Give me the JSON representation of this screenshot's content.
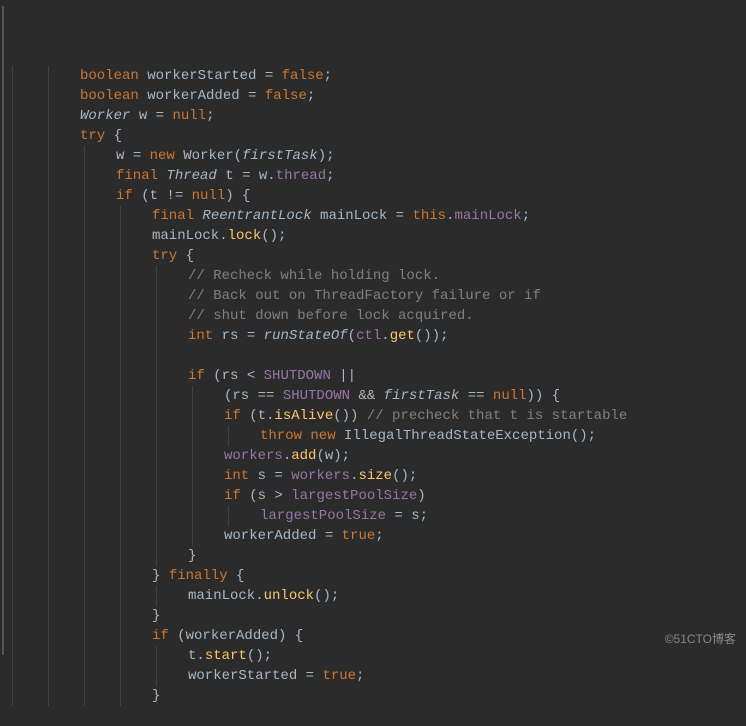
{
  "watermark": "©51CTO博客",
  "code": {
    "lines": [
      {
        "indent": 2,
        "tokens": [
          [
            "kw",
            "boolean"
          ],
          [
            "plain",
            " workerStarted "
          ],
          [
            "op",
            "="
          ],
          [
            "plain",
            " "
          ],
          [
            "kw",
            "false"
          ],
          [
            "plain",
            ";"
          ]
        ]
      },
      {
        "indent": 2,
        "tokens": [
          [
            "kw",
            "boolean"
          ],
          [
            "plain",
            " workerAdded "
          ],
          [
            "op",
            "="
          ],
          [
            "plain",
            " "
          ],
          [
            "kw",
            "false"
          ],
          [
            "plain",
            ";"
          ]
        ]
      },
      {
        "indent": 2,
        "tokens": [
          [
            "type",
            "Worker"
          ],
          [
            "plain",
            " w "
          ],
          [
            "op",
            "="
          ],
          [
            "plain",
            " "
          ],
          [
            "kw",
            "null"
          ],
          [
            "plain",
            ";"
          ]
        ]
      },
      {
        "indent": 2,
        "tokens": [
          [
            "kw",
            "try"
          ],
          [
            "plain",
            " {"
          ]
        ]
      },
      {
        "indent": 3,
        "tokens": [
          [
            "plain",
            "w "
          ],
          [
            "op",
            "="
          ],
          [
            "plain",
            " "
          ],
          [
            "kw",
            "new"
          ],
          [
            "plain",
            " Worker("
          ],
          [
            "param",
            "firstTask"
          ],
          [
            "plain",
            ");"
          ]
        ]
      },
      {
        "indent": 3,
        "tokens": [
          [
            "kw",
            "final"
          ],
          [
            "plain",
            " "
          ],
          [
            "type",
            "Thread"
          ],
          [
            "plain",
            " t "
          ],
          [
            "op",
            "="
          ],
          [
            "plain",
            " w."
          ],
          [
            "field",
            "thread"
          ],
          [
            "plain",
            ";"
          ]
        ]
      },
      {
        "indent": 3,
        "tokens": [
          [
            "kw",
            "if"
          ],
          [
            "plain",
            " (t "
          ],
          [
            "op",
            "!="
          ],
          [
            "plain",
            " "
          ],
          [
            "kw",
            "null"
          ],
          [
            "plain",
            ") {"
          ]
        ]
      },
      {
        "indent": 4,
        "tokens": [
          [
            "kw",
            "final"
          ],
          [
            "plain",
            " "
          ],
          [
            "type",
            "ReentrantLock"
          ],
          [
            "plain",
            " mainLock "
          ],
          [
            "op",
            "="
          ],
          [
            "plain",
            " "
          ],
          [
            "kw",
            "this"
          ],
          [
            "plain",
            "."
          ],
          [
            "field",
            "mainLock"
          ],
          [
            "plain",
            ";"
          ]
        ]
      },
      {
        "indent": 4,
        "tokens": [
          [
            "plain",
            "mainLock."
          ],
          [
            "fn",
            "lock"
          ],
          [
            "plain",
            "();"
          ]
        ]
      },
      {
        "indent": 4,
        "tokens": [
          [
            "kw",
            "try"
          ],
          [
            "plain",
            " {"
          ]
        ]
      },
      {
        "indent": 5,
        "tokens": [
          [
            "comment",
            "// Recheck while holding lock."
          ]
        ]
      },
      {
        "indent": 5,
        "tokens": [
          [
            "comment",
            "// Back out on ThreadFactory failure or if"
          ]
        ]
      },
      {
        "indent": 5,
        "tokens": [
          [
            "comment",
            "// shut down before lock acquired."
          ]
        ]
      },
      {
        "indent": 5,
        "tokens": [
          [
            "kw",
            "int"
          ],
          [
            "plain",
            " rs "
          ],
          [
            "op",
            "="
          ],
          [
            "plain",
            " "
          ],
          [
            "param",
            "runStateOf"
          ],
          [
            "plain",
            "("
          ],
          [
            "field",
            "ctl"
          ],
          [
            "plain",
            "."
          ],
          [
            "fn",
            "get"
          ],
          [
            "plain",
            "());"
          ]
        ]
      },
      {
        "indent": 5,
        "tokens": [
          [
            "plain",
            ""
          ]
        ]
      },
      {
        "indent": 5,
        "tokens": [
          [
            "kw",
            "if"
          ],
          [
            "plain",
            " (rs "
          ],
          [
            "op",
            "<"
          ],
          [
            "plain",
            " "
          ],
          [
            "static-field",
            "SHUTDOWN"
          ],
          [
            "plain",
            " "
          ],
          [
            "op",
            "||"
          ]
        ]
      },
      {
        "indent": 6,
        "tokens": [
          [
            "plain",
            "(rs "
          ],
          [
            "op",
            "=="
          ],
          [
            "plain",
            " "
          ],
          [
            "static-field",
            "SHUTDOWN"
          ],
          [
            "plain",
            " "
          ],
          [
            "op",
            "&&"
          ],
          [
            "plain",
            " "
          ],
          [
            "param",
            "firstTask"
          ],
          [
            "plain",
            " "
          ],
          [
            "op",
            "=="
          ],
          [
            "plain",
            " "
          ],
          [
            "kw",
            "null"
          ],
          [
            "plain",
            ")) {"
          ]
        ]
      },
      {
        "indent": 6,
        "tokens": [
          [
            "kw",
            "if"
          ],
          [
            "plain",
            " (t."
          ],
          [
            "fn",
            "isAlive"
          ],
          [
            "plain",
            "()) "
          ],
          [
            "comment",
            "// precheck that t is startable"
          ]
        ]
      },
      {
        "indent": 7,
        "tokens": [
          [
            "kw",
            "throw new"
          ],
          [
            "plain",
            " IllegalThreadStateException();"
          ]
        ]
      },
      {
        "indent": 6,
        "tokens": [
          [
            "field",
            "workers"
          ],
          [
            "plain",
            "."
          ],
          [
            "fn",
            "add"
          ],
          [
            "plain",
            "(w);"
          ]
        ]
      },
      {
        "indent": 6,
        "tokens": [
          [
            "kw",
            "int"
          ],
          [
            "plain",
            " s "
          ],
          [
            "op",
            "="
          ],
          [
            "plain",
            " "
          ],
          [
            "field",
            "workers"
          ],
          [
            "plain",
            "."
          ],
          [
            "fn",
            "size"
          ],
          [
            "plain",
            "();"
          ]
        ]
      },
      {
        "indent": 6,
        "tokens": [
          [
            "kw",
            "if"
          ],
          [
            "plain",
            " (s "
          ],
          [
            "op",
            ">"
          ],
          [
            "plain",
            " "
          ],
          [
            "field",
            "largestPoolSize"
          ],
          [
            "plain",
            ")"
          ]
        ]
      },
      {
        "indent": 7,
        "tokens": [
          [
            "field",
            "largestPoolSize"
          ],
          [
            "plain",
            " "
          ],
          [
            "op",
            "="
          ],
          [
            "plain",
            " s;"
          ]
        ]
      },
      {
        "indent": 6,
        "tokens": [
          [
            "plain",
            "workerAdded "
          ],
          [
            "op",
            "="
          ],
          [
            "plain",
            " "
          ],
          [
            "kw",
            "true"
          ],
          [
            "plain",
            ";"
          ]
        ]
      },
      {
        "indent": 5,
        "tokens": [
          [
            "plain",
            "}"
          ]
        ]
      },
      {
        "indent": 4,
        "tokens": [
          [
            "plain",
            "} "
          ],
          [
            "kw",
            "finally"
          ],
          [
            "plain",
            " {"
          ]
        ]
      },
      {
        "indent": 5,
        "tokens": [
          [
            "plain",
            "mainLock."
          ],
          [
            "fn",
            "unlock"
          ],
          [
            "plain",
            "();"
          ]
        ]
      },
      {
        "indent": 4,
        "tokens": [
          [
            "plain",
            "}"
          ]
        ]
      },
      {
        "indent": 4,
        "tokens": [
          [
            "kw",
            "if"
          ],
          [
            "plain",
            " (workerAdded) {"
          ]
        ]
      },
      {
        "indent": 5,
        "tokens": [
          [
            "plain",
            "t."
          ],
          [
            "fn",
            "start"
          ],
          [
            "plain",
            "();"
          ]
        ]
      },
      {
        "indent": 5,
        "tokens": [
          [
            "plain",
            "workerStarted "
          ],
          [
            "op",
            "="
          ],
          [
            "plain",
            " "
          ],
          [
            "kw",
            "true"
          ],
          [
            "plain",
            ";"
          ]
        ]
      },
      {
        "indent": 4,
        "tokens": [
          [
            "plain",
            "}"
          ]
        ]
      }
    ]
  }
}
